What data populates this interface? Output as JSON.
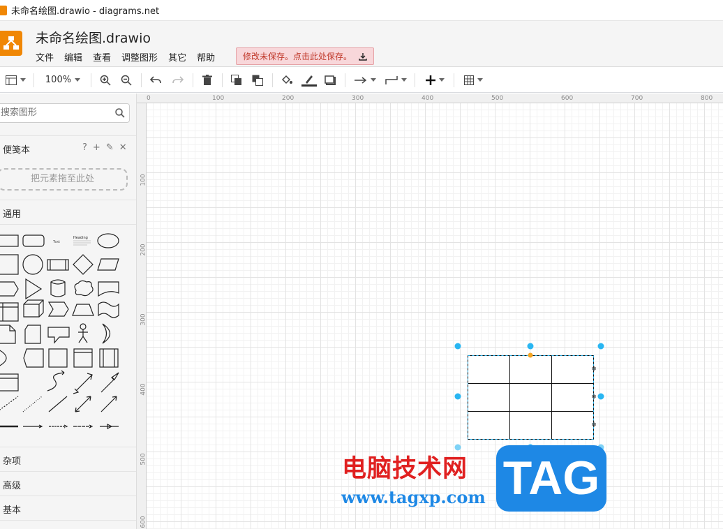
{
  "window": {
    "title": "未命名绘图.drawio - diagrams.net"
  },
  "app": {
    "filename": "未命名绘图.drawio",
    "menu": [
      "文件",
      "编辑",
      "查看",
      "调整图形",
      "其它",
      "帮助"
    ],
    "save_warning": "修改未保存。点击此处保存。"
  },
  "toolbar": {
    "zoom": "100%"
  },
  "sidebar": {
    "search_placeholder": "搜索图形",
    "scratchpad_label": "便笺本",
    "scratch_tools": [
      "?",
      "+",
      "✎",
      "✕"
    ],
    "dropzone_text": "把元素拖至此处",
    "sections": [
      "通用",
      "杂项",
      "高级",
      "基本"
    ],
    "shape_text_label": "Text",
    "shape_heading_label": "Heading"
  },
  "ruler": {
    "top": [
      "0",
      "100",
      "200",
      "300",
      "400",
      "500",
      "600",
      "700",
      "800"
    ],
    "left": [
      "100",
      "200",
      "300",
      "400",
      "500",
      "600"
    ]
  },
  "watermark": {
    "text": "电脑技术网",
    "url": "www.tagxp.com",
    "badge": "TAG"
  },
  "colors": {
    "accent": "#f08705",
    "selection": "#29b6f2",
    "warning_bg": "#f8d7da",
    "warning_text": "#c0392b",
    "watermark_red": "#e02020",
    "watermark_blue": "#1e88e5"
  }
}
